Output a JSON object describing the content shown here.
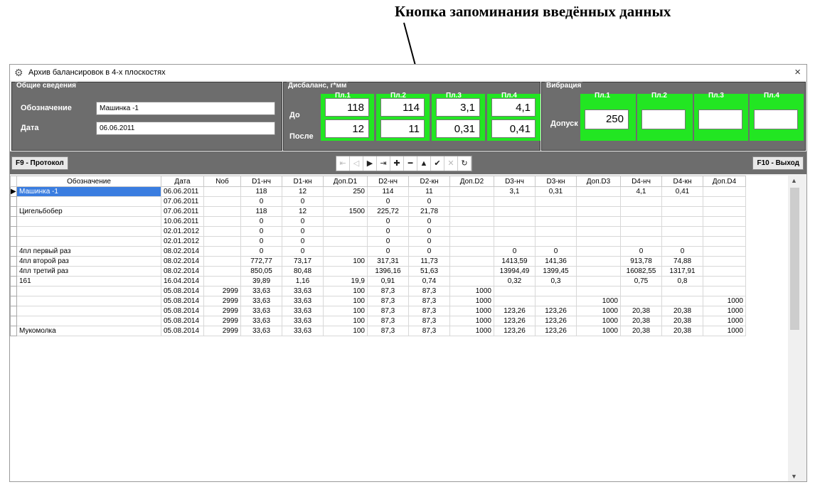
{
  "annotation": "Кнопка запоминания введённых данных",
  "window": {
    "title": "Архив балансировок в 4-х плоскостях",
    "close": "×",
    "icon": "gear-icon"
  },
  "general": {
    "label": "Общие сведения",
    "designation_label": "Обозначение",
    "designation_value": "Машинка -1",
    "date_label": "Дата",
    "date_value": "06.06.2011"
  },
  "imbalance": {
    "label": "Дисбаланс, г*мм",
    "before_label": "До",
    "after_label": "После",
    "planes": [
      {
        "name": "Пл.1",
        "before": "118",
        "after": "12"
      },
      {
        "name": "Пл.2",
        "before": "114",
        "after": "11"
      },
      {
        "name": "Пл.3",
        "before": "3,1",
        "after": "0,31"
      },
      {
        "name": "Пл.4",
        "before": "4,1",
        "after": "0,41"
      }
    ]
  },
  "vibration": {
    "label": "Вибрация",
    "tolerance_label": "Допуск",
    "planes": [
      {
        "name": "Пл.1",
        "value": "250"
      },
      {
        "name": "Пл.2",
        "value": ""
      },
      {
        "name": "Пл.3",
        "value": ""
      },
      {
        "name": "Пл.4",
        "value": ""
      }
    ]
  },
  "toolbar": {
    "protocol": "F9 - Протокол",
    "exit": "F10 - Выход",
    "nav": [
      "⇤",
      "◁",
      "▶",
      "⇥",
      "✚",
      "━",
      "▲",
      "✔",
      "✕",
      "↻"
    ]
  },
  "colors": {
    "panel": "#6d6d6d",
    "green": "#22e622",
    "selection": "#3a7de0"
  },
  "table": {
    "columns": [
      "Обозначение",
      "Дата",
      "Nоб",
      "D1-нч",
      "D1-кн",
      "Доп.D1",
      "D2-нч",
      "D2-кн",
      "Доп.D2",
      "D3-нч",
      "D3-кн",
      "Доп.D3",
      "D4-нч",
      "D4-кн",
      "Доп.D4"
    ],
    "rows": [
      [
        "Машинка -1",
        "06.06.2011",
        "",
        "118",
        "12",
        "250",
        "114",
        "11",
        "",
        "3,1",
        "0,31",
        "",
        "4,1",
        "0,41",
        ""
      ],
      [
        "",
        "07.06.2011",
        "",
        "0",
        "0",
        "",
        "0",
        "0",
        "",
        "",
        "",
        "",
        "",
        "",
        ""
      ],
      [
        "Цигельбобер",
        "07.06.2011",
        "",
        "118",
        "12",
        "1500",
        "225,72",
        "21,78",
        "",
        "",
        "",
        "",
        "",
        "",
        ""
      ],
      [
        "",
        "10.06.2011",
        "",
        "0",
        "0",
        "",
        "0",
        "0",
        "",
        "",
        "",
        "",
        "",
        "",
        ""
      ],
      [
        "",
        "02.01.2012",
        "",
        "0",
        "0",
        "",
        "0",
        "0",
        "",
        "",
        "",
        "",
        "",
        "",
        ""
      ],
      [
        "",
        "02.01.2012",
        "",
        "0",
        "0",
        "",
        "0",
        "0",
        "",
        "",
        "",
        "",
        "",
        "",
        ""
      ],
      [
        "4пл первый раз",
        "08.02.2014",
        "",
        "0",
        "0",
        "",
        "0",
        "0",
        "",
        "0",
        "0",
        "",
        "0",
        "0",
        ""
      ],
      [
        "4пл второй раз",
        "08.02.2014",
        "",
        "772,77",
        "73,17",
        "100",
        "317,31",
        "11,73",
        "",
        "1413,59",
        "141,36",
        "",
        "913,78",
        "74,88",
        ""
      ],
      [
        "4пл третий раз",
        "08.02.2014",
        "",
        "850,05",
        "80,48",
        "",
        "1396,16",
        "51,63",
        "",
        "13994,49",
        "1399,45",
        "",
        "16082,55",
        "1317,91",
        ""
      ],
      [
        "161",
        "16.04.2014",
        "",
        "39,89",
        "1,16",
        "19,9",
        "0,91",
        "0,74",
        "",
        "0,32",
        "0,3",
        "",
        "0,75",
        "0,8",
        ""
      ],
      [
        "",
        "05.08.2014",
        "2999",
        "33,63",
        "33,63",
        "100",
        "87,3",
        "87,3",
        "1000",
        "",
        "",
        "",
        "",
        "",
        ""
      ],
      [
        "",
        "05.08.2014",
        "2999",
        "33,63",
        "33,63",
        "100",
        "87,3",
        "87,3",
        "1000",
        "",
        "",
        "1000",
        "",
        "",
        "1000"
      ],
      [
        "",
        "05.08.2014",
        "2999",
        "33,63",
        "33,63",
        "100",
        "87,3",
        "87,3",
        "1000",
        "123,26",
        "123,26",
        "1000",
        "20,38",
        "20,38",
        "1000"
      ],
      [
        "",
        "05.08.2014",
        "2999",
        "33,63",
        "33,63",
        "100",
        "87,3",
        "87,3",
        "1000",
        "123,26",
        "123,26",
        "1000",
        "20,38",
        "20,38",
        "1000"
      ],
      [
        "Мукомолка",
        "05.08.2014",
        "2999",
        "33,63",
        "33,63",
        "100",
        "87,3",
        "87,3",
        "1000",
        "123,26",
        "123,26",
        "1000",
        "20,38",
        "20,38",
        "1000"
      ]
    ]
  }
}
